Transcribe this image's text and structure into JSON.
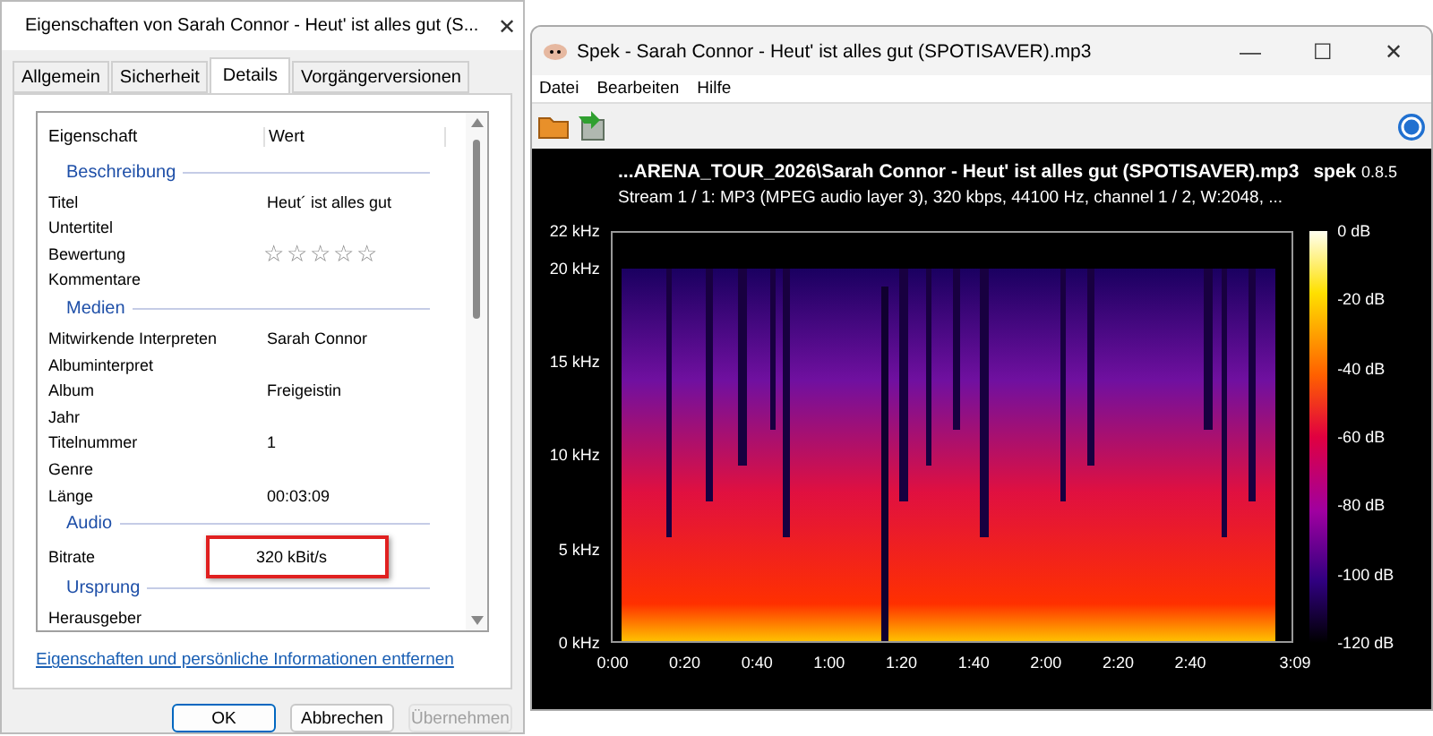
{
  "properties_window": {
    "title": "Eigenschaften von Sarah Connor - Heut' ist alles gut (S...",
    "close": "✕",
    "tabs": [
      {
        "label": "Allgemein",
        "selected": false
      },
      {
        "label": "Sicherheit",
        "selected": false
      },
      {
        "label": "Details",
        "selected": true
      },
      {
        "label": "Vorgängerversionen",
        "selected": false
      }
    ],
    "columns": [
      "Eigenschaft",
      "Wert"
    ],
    "rows": [
      {
        "kind": "group",
        "label": "Beschreibung"
      },
      {
        "kind": "property",
        "label": "Titel",
        "value": "Heut´ ist alles gut"
      },
      {
        "kind": "property",
        "label": "Untertitel"
      },
      {
        "kind": "rating",
        "label": "Bewertung",
        "stars": 0
      },
      {
        "kind": "property",
        "label": "Kommentare"
      },
      {
        "kind": "group",
        "label": "Medien"
      },
      {
        "kind": "property",
        "label": "Mitwirkende Interpreten",
        "value": "Sarah Connor"
      },
      {
        "kind": "property",
        "label": "Albuminterpret"
      },
      {
        "kind": "property",
        "label": "Album",
        "value": "Freigeistin"
      },
      {
        "kind": "property",
        "label": "Jahr"
      },
      {
        "kind": "property",
        "label": "Titelnummer",
        "value": "1"
      },
      {
        "kind": "property",
        "label": "Genre"
      },
      {
        "kind": "property",
        "label": "Länge",
        "value": "00:03:09"
      },
      {
        "kind": "group",
        "label": "Audio"
      },
      {
        "kind": "property",
        "label": "Bitrate",
        "value": "320 kBit/s",
        "highlighted": true
      },
      {
        "kind": "group",
        "label": "Ursprung"
      },
      {
        "kind": "property",
        "label": "Herausgeber"
      }
    ],
    "link": "Eigenschaften und persönliche Informationen entfernen",
    "buttons": [
      {
        "label": "OK",
        "disabled": false,
        "default": true
      },
      {
        "label": "Abbrechen",
        "disabled": false,
        "default": false
      },
      {
        "label": "Übernehmen",
        "disabled": true,
        "default": false
      }
    ]
  },
  "spek_window": {
    "title": "Spek - Sarah Connor - Heut' ist alles gut (SPOTISAVER).mp3",
    "controls": [
      "—",
      "☐",
      "✕"
    ],
    "menu": [
      "Datei",
      "Bearbeiten",
      "Hilfe"
    ],
    "file_path": "...ARENA_TOUR_2026\\Sarah Connor - Heut' ist alles gut (SPOTISAVER).mp3",
    "app_name": "spek",
    "version": "0.8.5",
    "stream_info": "Stream 1 / 1: MP3 (MPEG audio layer 3), 320 kbps, 44100 Hz, channel 1 / 2, W:2048, ...",
    "y_labels": [
      "22 kHz",
      "20 kHz",
      "15 kHz",
      "10 kHz",
      "5 kHz",
      "0 kHz"
    ],
    "x_labels": [
      "0:00",
      "0:20",
      "0:40",
      "1:00",
      "1:20",
      "1:40",
      "2:00",
      "2:20",
      "2:40",
      "3:09"
    ],
    "db_labels": [
      "0 dB",
      "-20 dB",
      "-40 dB",
      "-60 dB",
      "-80 dB",
      "-100 dB",
      "-120 dB"
    ]
  }
}
